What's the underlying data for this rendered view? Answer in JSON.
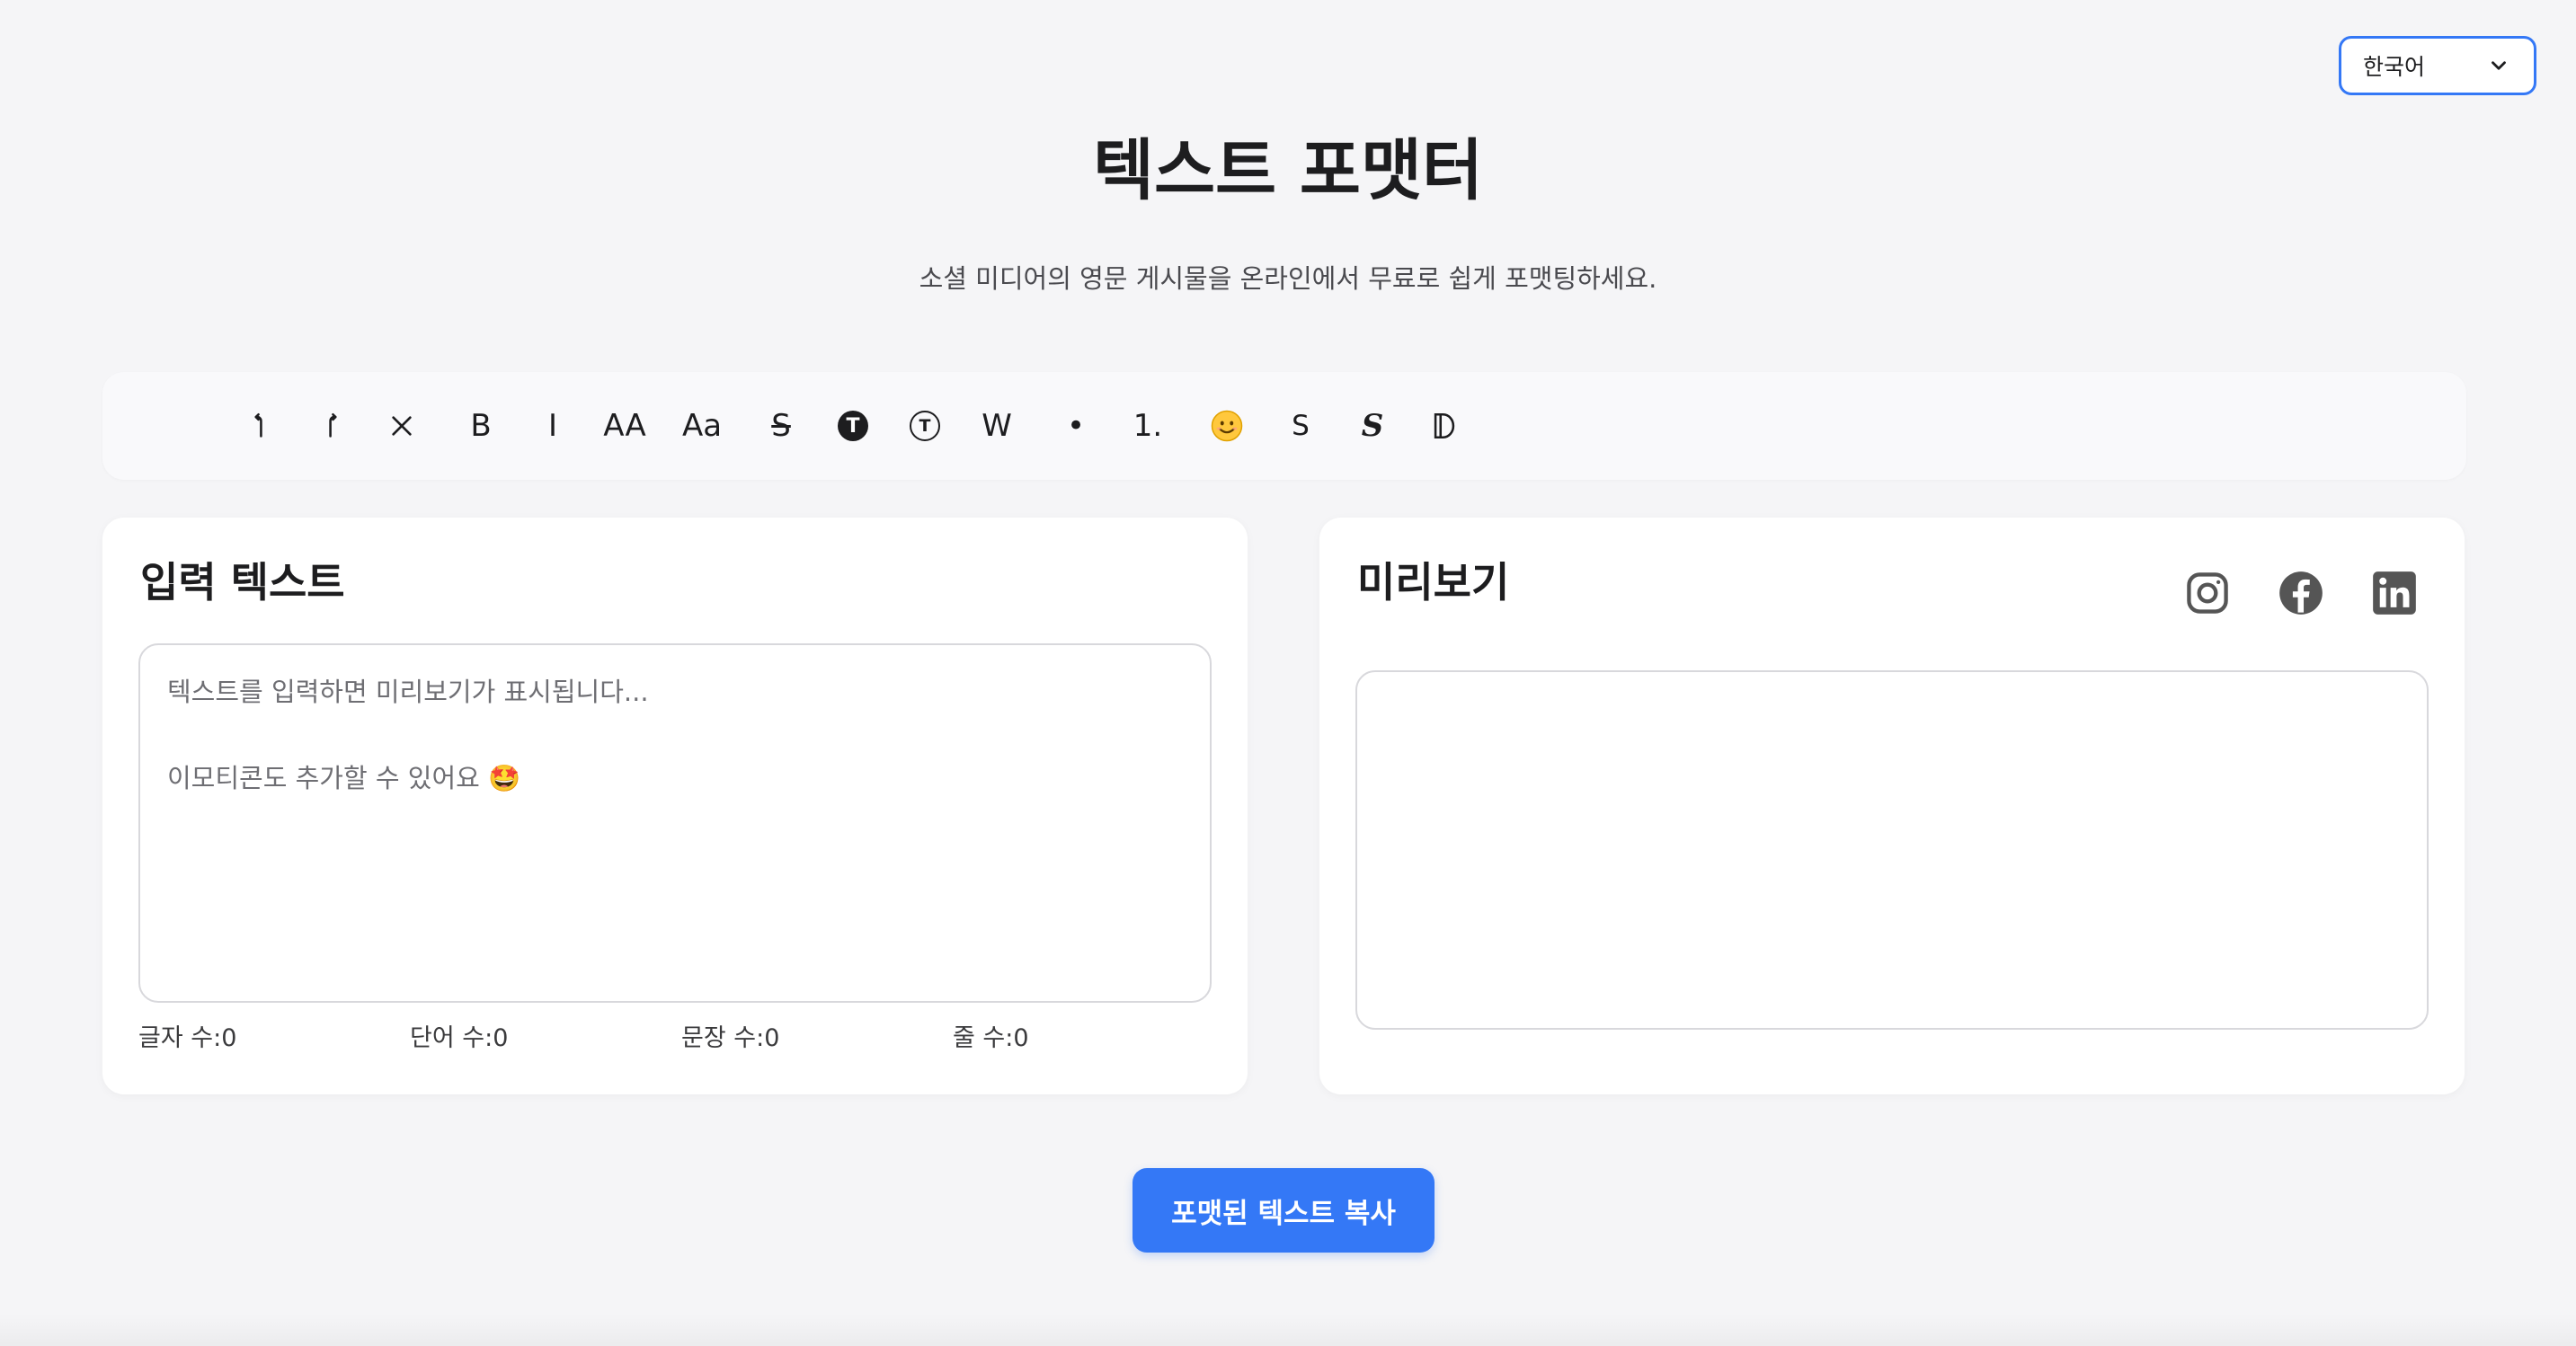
{
  "language_selector": {
    "selected": "한국어"
  },
  "header": {
    "title": "텍스트 포맷터",
    "subtitle": "소셜 미디어의 영문 게시물을 온라인에서 무료로 쉽게 포맷팅하세요."
  },
  "toolbar": {
    "buttons": [
      {
        "name": "undo",
        "label": "↰",
        "icon": "undo-icon"
      },
      {
        "name": "redo",
        "label": "↱",
        "icon": "redo-icon"
      },
      {
        "name": "clear",
        "label": "✕",
        "icon": "close-icon"
      },
      {
        "name": "bold",
        "label": "B"
      },
      {
        "name": "italic",
        "label": "I"
      },
      {
        "name": "uppercase",
        "label": "AA"
      },
      {
        "name": "capitalize",
        "label": "Aa"
      },
      {
        "name": "strikethrough",
        "label": "S"
      },
      {
        "name": "circled-filled",
        "label": "T"
      },
      {
        "name": "circled-outline",
        "label": "T"
      },
      {
        "name": "wide",
        "label": "W"
      },
      {
        "name": "bullet-list",
        "label": "•"
      },
      {
        "name": "numbered-list",
        "label": "1."
      },
      {
        "name": "emoji",
        "label": "😊",
        "icon": "smiley-icon"
      },
      {
        "name": "sans-serif",
        "label": "S"
      },
      {
        "name": "script",
        "label": "𝓼"
      },
      {
        "name": "double-struck",
        "label": "𝔻"
      }
    ]
  },
  "input_panel": {
    "title": "입력 텍스트",
    "placeholder": "텍스트를 입력하면 미리보기가 표시됩니다...\n\n이모티콘도 추가할 수 있어요 🤩",
    "stats": {
      "chars": "글자 수:0",
      "words": "단어 수:0",
      "sentences": "문장 수:0",
      "lines": "줄 수:0"
    }
  },
  "preview_panel": {
    "title": "미리보기",
    "icons": [
      "instagram-icon",
      "facebook-icon",
      "linkedin-icon"
    ]
  },
  "copy_button": {
    "label": "포맷된 텍스트 복사"
  },
  "colors": {
    "accent": "#3478f6",
    "background": "#f5f5f7",
    "icon_gray": "#555555"
  }
}
